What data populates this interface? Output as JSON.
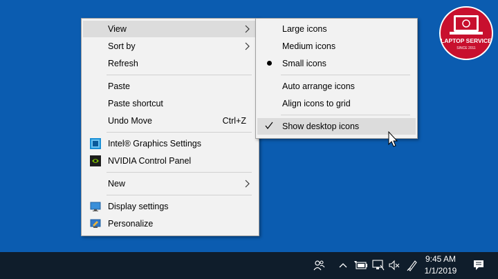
{
  "context_menu": {
    "items": [
      {
        "label": "View",
        "submenu": true,
        "highlighted": true
      },
      {
        "label": "Sort by",
        "submenu": true
      },
      {
        "label": "Refresh"
      },
      {
        "label": "Paste"
      },
      {
        "label": "Paste shortcut"
      },
      {
        "label": "Undo Move",
        "shortcut": "Ctrl+Z"
      },
      {
        "label": "Intel® Graphics Settings",
        "icon": "intel-graphics-icon"
      },
      {
        "label": "NVIDIA Control Panel",
        "icon": "nvidia-icon"
      },
      {
        "label": "New",
        "submenu": true
      },
      {
        "label": "Display settings",
        "icon": "display-settings-icon"
      },
      {
        "label": "Personalize",
        "icon": "personalize-icon"
      }
    ]
  },
  "view_submenu": {
    "items": [
      {
        "label": "Large icons"
      },
      {
        "label": "Medium icons"
      },
      {
        "label": "Small icons",
        "selected": true
      },
      {
        "label": "Auto arrange icons"
      },
      {
        "label": "Align icons to grid"
      },
      {
        "label": "Show desktop icons",
        "checked": true,
        "highlighted": true
      }
    ]
  },
  "taskbar": {
    "tray_icons": [
      "people-icon",
      "chevron-up-icon",
      "battery-icon",
      "network-icon",
      "volume-muted-icon",
      "pen-icon",
      "notifications-icon"
    ],
    "time": "9:45 AM",
    "date": "1/1/2019"
  },
  "watermark": {
    "brand": "LAPTOP SERVICE",
    "tagline": "SINCE 2011"
  },
  "colors": {
    "desktop": "#0b5cb0",
    "menu_bg": "#f2f2f2",
    "menu_highlight": "#dcdcdc",
    "taskbar": "#0f1d2b"
  }
}
